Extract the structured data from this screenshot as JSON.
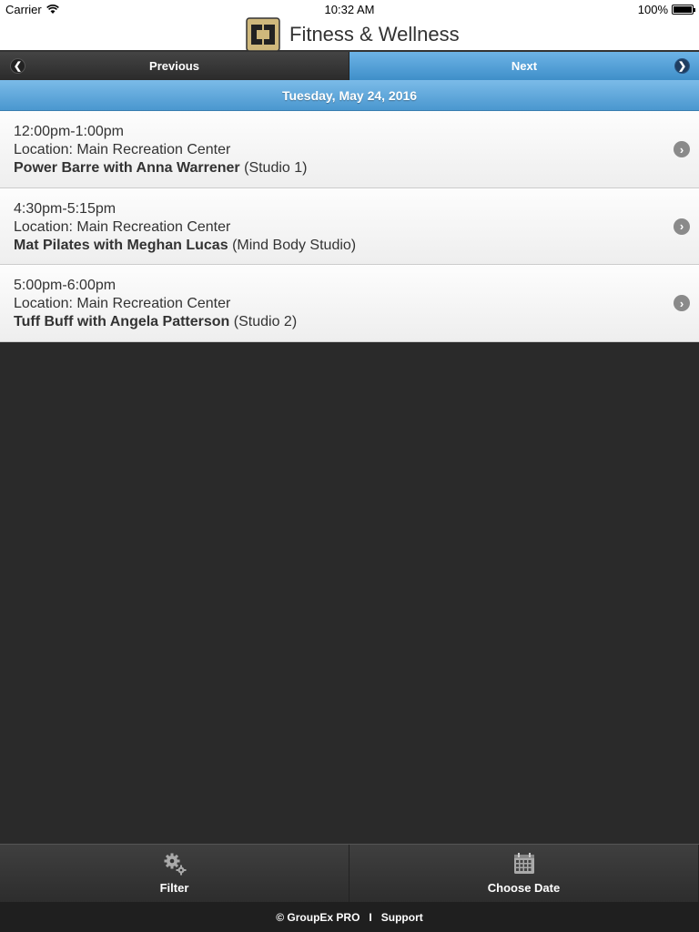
{
  "status_bar": {
    "carrier": "Carrier",
    "time": "10:32 AM",
    "battery": "100%"
  },
  "header": {
    "title": "Fitness & Wellness"
  },
  "nav": {
    "previous_label": "Previous",
    "next_label": "Next"
  },
  "date": "Tuesday, May 24, 2016",
  "classes": [
    {
      "time": "12:00pm-1:00pm",
      "location": "Location: Main Recreation Center",
      "name": "Power Barre with Anna Warrener",
      "room": "(Studio 1)"
    },
    {
      "time": "4:30pm-5:15pm",
      "location": "Location: Main Recreation Center",
      "name": "Mat Pilates with Meghan Lucas",
      "room": "(Mind Body Studio)"
    },
    {
      "time": "5:00pm-6:00pm",
      "location": "Location: Main Recreation Center",
      "name": "Tuff Buff with Angela Patterson",
      "room": "(Studio 2)"
    }
  ],
  "toolbar": {
    "filter_label": "Filter",
    "choose_date_label": "Choose Date"
  },
  "footer": {
    "copyright": "© GroupEx PRO",
    "separator": "I",
    "support": "Support"
  },
  "colors": {
    "accent_blue": "#4a97cf",
    "logo_gold": "#cfb87c",
    "background": "#2a2a2a"
  },
  "icons": {
    "prev": "chevron-left-icon",
    "next": "chevron-right-icon",
    "filter": "gears-icon",
    "choose_date": "calendar-icon"
  }
}
